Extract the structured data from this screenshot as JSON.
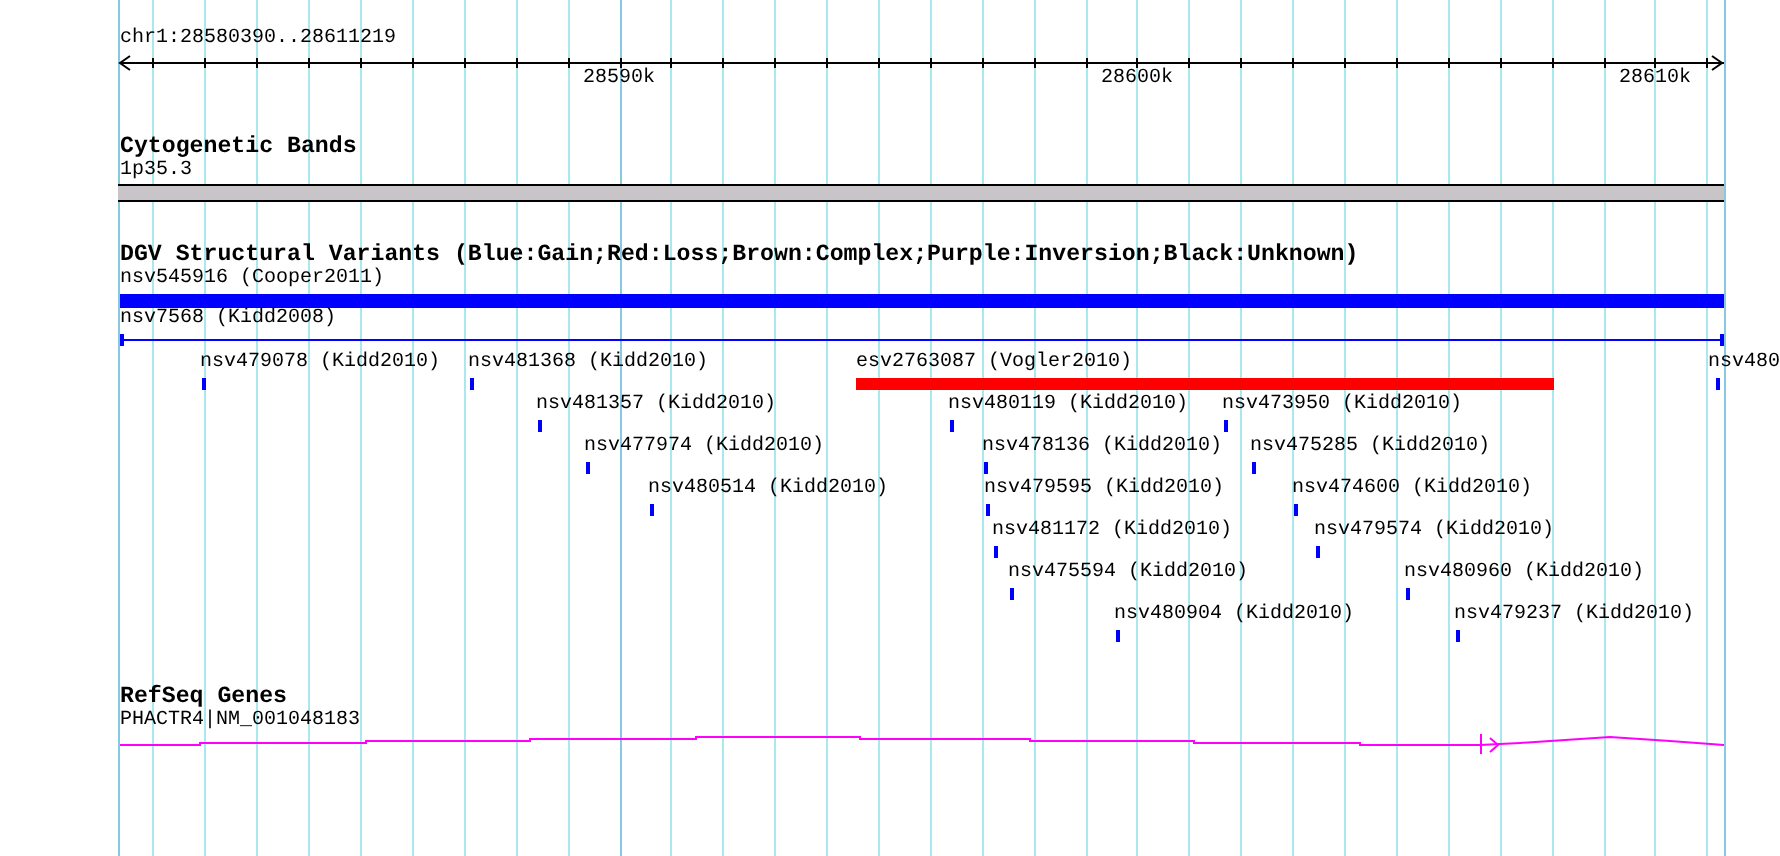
{
  "scale": {
    "label": "chr1:28580390..28611219",
    "ticks": [
      "28590k",
      "28600k",
      "28610k"
    ]
  },
  "cytogenetic_bands": {
    "title": "Cytogenetic Bands",
    "band": "1p35.3"
  },
  "dgv": {
    "title": "DGV Structural Variants (Blue:Gain;Red:Loss;Brown:Complex;Purple:Inversion;Black:Unknown)",
    "features": [
      {
        "label": "nsv545916 (Cooper2011)",
        "kind": "bar",
        "color": "#0000ff"
      },
      {
        "label": "nsv7568 (Kidd2008)",
        "kind": "span",
        "color": "#0000ff"
      },
      {
        "label": "nsv479078 (Kidd2010)",
        "kind": "point",
        "color": "#0000ff"
      },
      {
        "label": "nsv481368 (Kidd2010)",
        "kind": "point",
        "color": "#0000ff"
      },
      {
        "label": "esv2763087 (Vogler2010)",
        "kind": "bar",
        "color": "#ff0000"
      },
      {
        "label": "nsv480",
        "kind": "point",
        "color": "#0000ff"
      },
      {
        "label": "nsv481357 (Kidd2010)",
        "kind": "point",
        "color": "#0000ff"
      },
      {
        "label": "nsv480119 (Kidd2010)",
        "kind": "point",
        "color": "#0000ff"
      },
      {
        "label": "nsv473950 (Kidd2010)",
        "kind": "point",
        "color": "#0000ff"
      },
      {
        "label": "nsv477974 (Kidd2010)",
        "kind": "point",
        "color": "#0000ff"
      },
      {
        "label": "nsv478136 (Kidd2010)",
        "kind": "point",
        "color": "#0000ff"
      },
      {
        "label": "nsv475285 (Kidd2010)",
        "kind": "point",
        "color": "#0000ff"
      },
      {
        "label": "nsv480514 (Kidd2010)",
        "kind": "point",
        "color": "#0000ff"
      },
      {
        "label": "nsv479595 (Kidd2010)",
        "kind": "point",
        "color": "#0000ff"
      },
      {
        "label": "nsv474600 (Kidd2010)",
        "kind": "point",
        "color": "#0000ff"
      },
      {
        "label": "nsv481172 (Kidd2010)",
        "kind": "point",
        "color": "#0000ff"
      },
      {
        "label": "nsv479574 (Kidd2010)",
        "kind": "point",
        "color": "#0000ff"
      },
      {
        "label": "nsv475594 (Kidd2010)",
        "kind": "point",
        "color": "#0000ff"
      },
      {
        "label": "nsv480960 (Kidd2010)",
        "kind": "point",
        "color": "#0000ff"
      },
      {
        "label": "nsv480904 (Kidd2010)",
        "kind": "point",
        "color": "#0000ff"
      },
      {
        "label": "nsv479237 (Kidd2010)",
        "kind": "point",
        "color": "#0000ff"
      }
    ]
  },
  "refseq_genes": {
    "title": "RefSeq Genes",
    "gene": "PHACTR4|NM_001048183"
  }
}
